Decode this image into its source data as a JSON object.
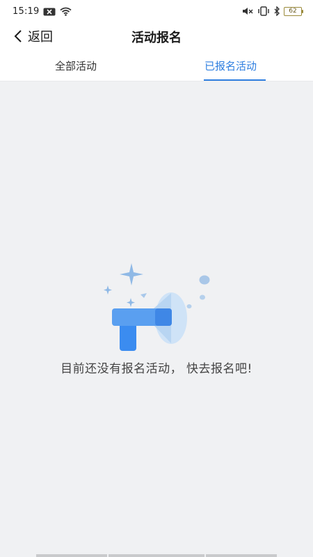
{
  "status_bar": {
    "time": "15:19",
    "battery": "62",
    "icons": [
      "notification-icon",
      "wifi-icon",
      "mute-icon",
      "vibrate-icon",
      "bluetooth-icon",
      "battery-icon"
    ]
  },
  "nav": {
    "back_label": "返回",
    "title": "活动报名"
  },
  "tabs": [
    {
      "label": "全部活动",
      "active": false
    },
    {
      "label": "已报名活动",
      "active": true
    }
  ],
  "empty_state": {
    "message": "目前还没有报名活动， 快去报名吧!",
    "icon": "megaphone-icon"
  },
  "colors": {
    "accent": "#2f7fe0",
    "background": "#f0f1f3",
    "illustration_blue": "#3b8cf0"
  }
}
